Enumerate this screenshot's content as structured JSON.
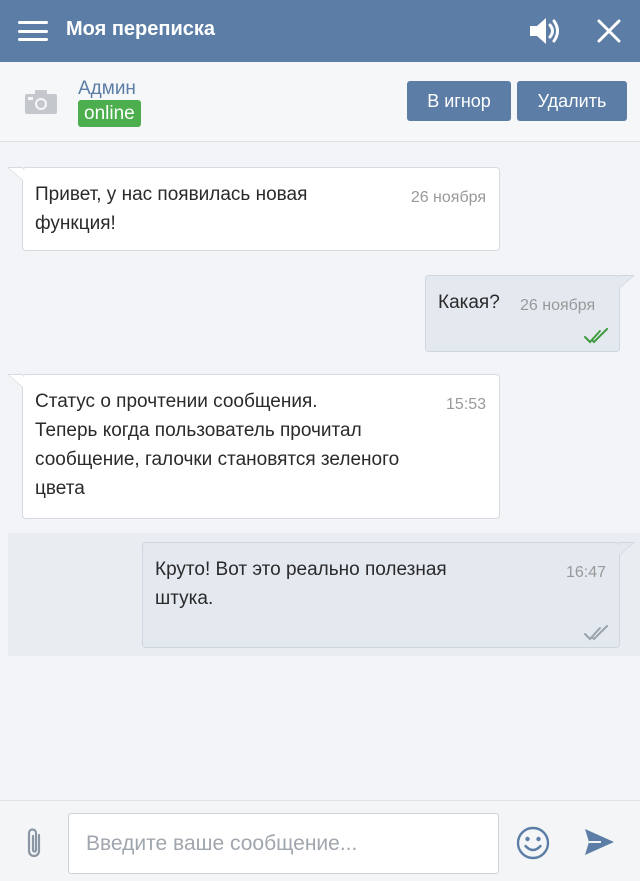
{
  "header": {
    "title": "Моя переписка",
    "icons": [
      "menu-icon",
      "sound-icon",
      "close-icon"
    ],
    "color": "#5b7da6"
  },
  "contact": {
    "name": "Админ",
    "status": "online",
    "status_color": "#4cae4c",
    "avatar_icon": "camera-icon",
    "ignore_label": "В игнор",
    "delete_label": "Удалить"
  },
  "messages": [
    {
      "direction": "in",
      "lines": [
        "Привет, у нас появилась новая",
        "функция!"
      ],
      "time": "26 ноября"
    },
    {
      "direction": "out",
      "lines": [
        "Какая?"
      ],
      "time": "26 ноября",
      "read": true
    },
    {
      "direction": "in",
      "lines": [
        "Статус о прочтении сообщения.",
        "Теперь когда пользователь прочитал",
        "сообщение, галочки становятся зеленого",
        "цвета"
      ],
      "time": "15:53"
    },
    {
      "direction": "out",
      "lines": [
        "Круто! Вот это реально полезная",
        "штука."
      ],
      "time": "16:47",
      "read": false
    }
  ],
  "composer": {
    "placeholder": "Введите ваше сообщение...",
    "value": "",
    "icons": [
      "paperclip-icon",
      "smile-icon",
      "send-icon"
    ]
  },
  "colors": {
    "read_check": "#3f9a3f",
    "unread_check": "#9aa3ad"
  }
}
